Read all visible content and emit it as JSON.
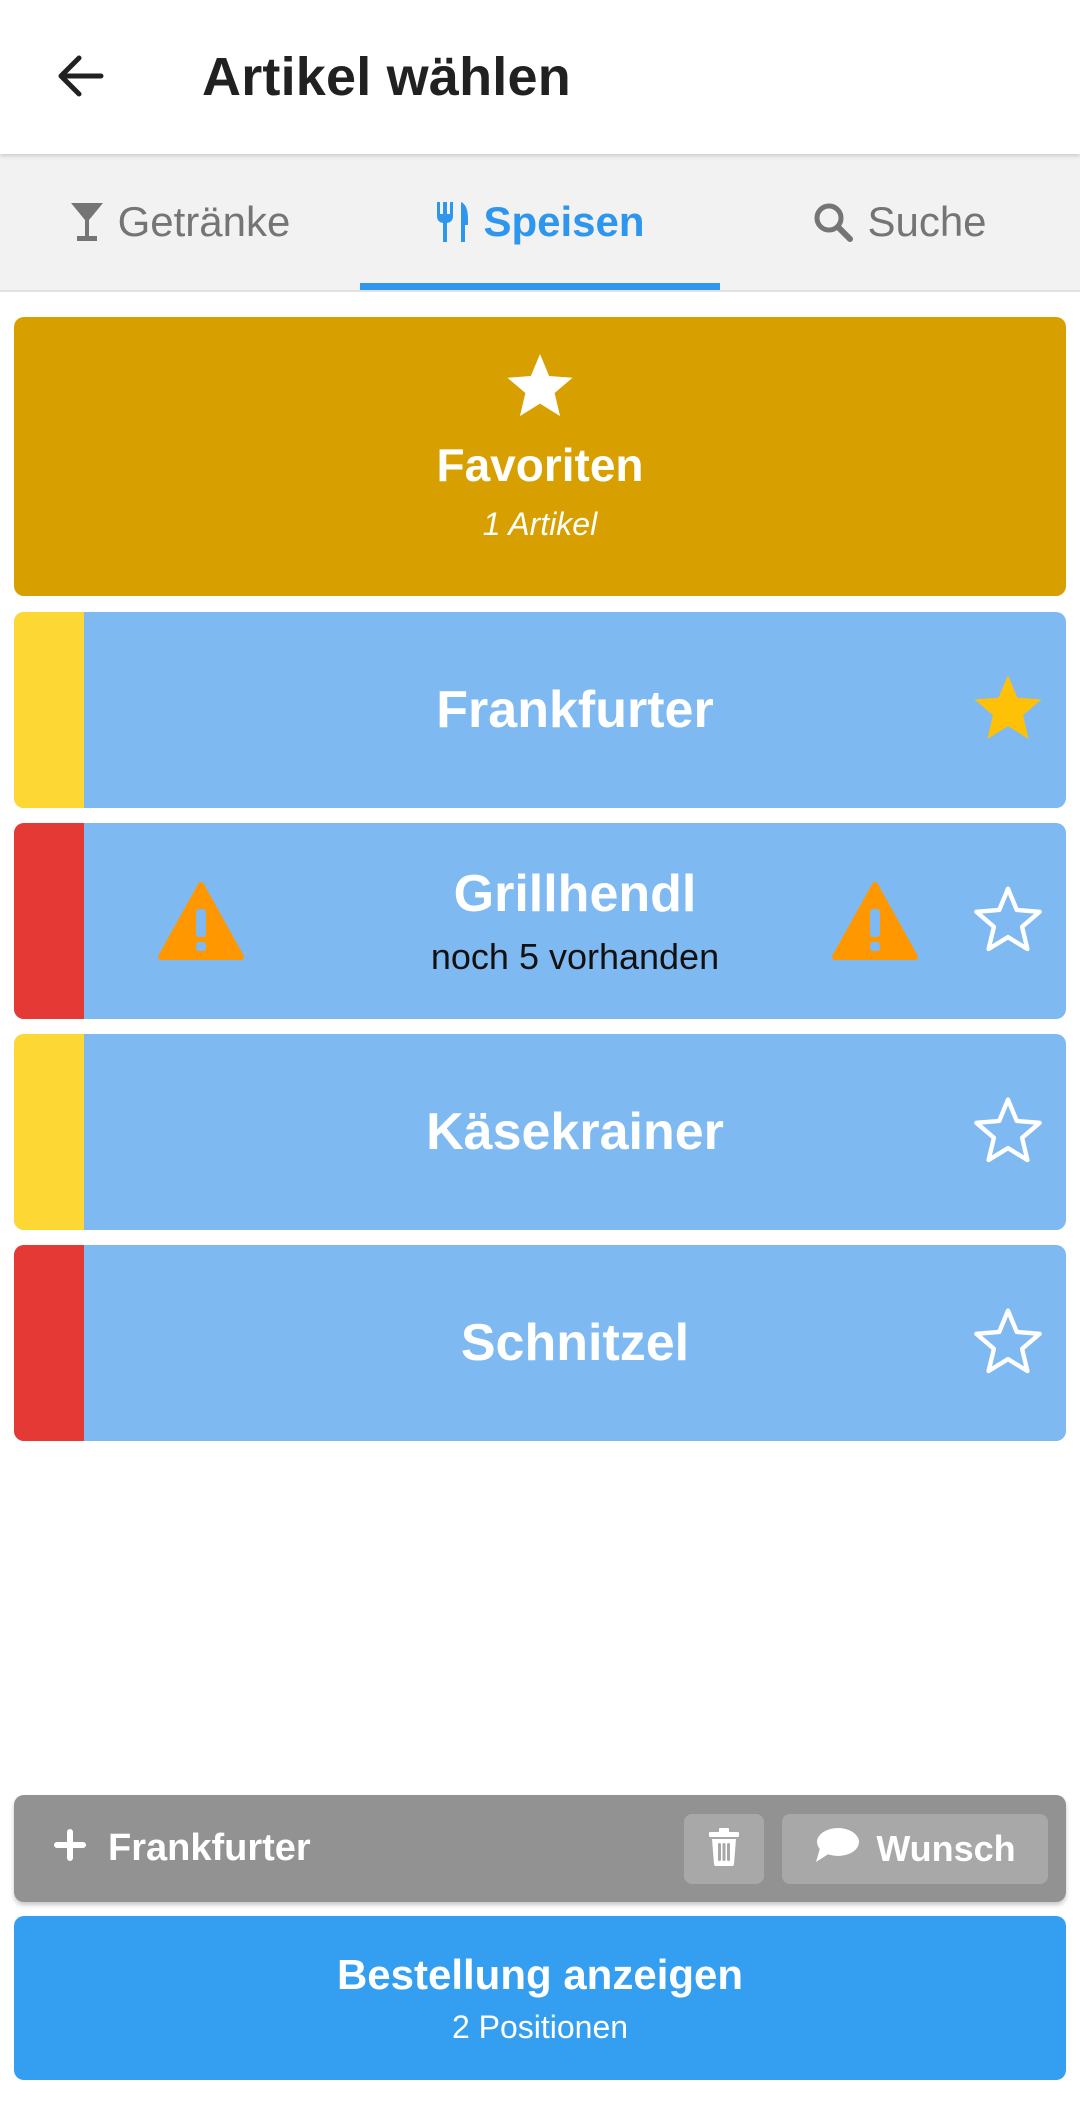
{
  "header": {
    "title": "Artikel wählen",
    "back_icon": "arrow-left-icon"
  },
  "tabs": [
    {
      "label": "Getränke",
      "icon": "cocktail-glass-icon",
      "active": false
    },
    {
      "label": "Speisen",
      "icon": "utensils-icon",
      "active": true
    },
    {
      "label": "Suche",
      "icon": "search-icon",
      "active": false
    }
  ],
  "favorites": {
    "title": "Favoriten",
    "subtitle": "1 Artikel",
    "icon": "star-icon",
    "color": "#d89f00"
  },
  "items": [
    {
      "name": "Frankfurter",
      "status": "",
      "stripe_color": "#fdd835",
      "favorite": true,
      "warning": false
    },
    {
      "name": "Grillhendl",
      "status": "noch 5 vorhanden",
      "stripe_color": "#e53935",
      "favorite": false,
      "warning": true
    },
    {
      "name": "Käsekrainer",
      "status": "",
      "stripe_color": "#fdd835",
      "favorite": false,
      "warning": false
    },
    {
      "name": "Schnitzel",
      "status": "",
      "stripe_color": "#e53935",
      "favorite": false,
      "warning": false
    }
  ],
  "current_item": {
    "label": "Frankfurter",
    "wish_label": "Wunsch"
  },
  "order": {
    "title": "Bestellung anzeigen",
    "subtitle": "2 Positionen"
  },
  "colors": {
    "accent": "#2e96ec",
    "item_bg": "#7fb9f1",
    "warning": "#ff9800",
    "favorite_star": "#ffc107"
  }
}
